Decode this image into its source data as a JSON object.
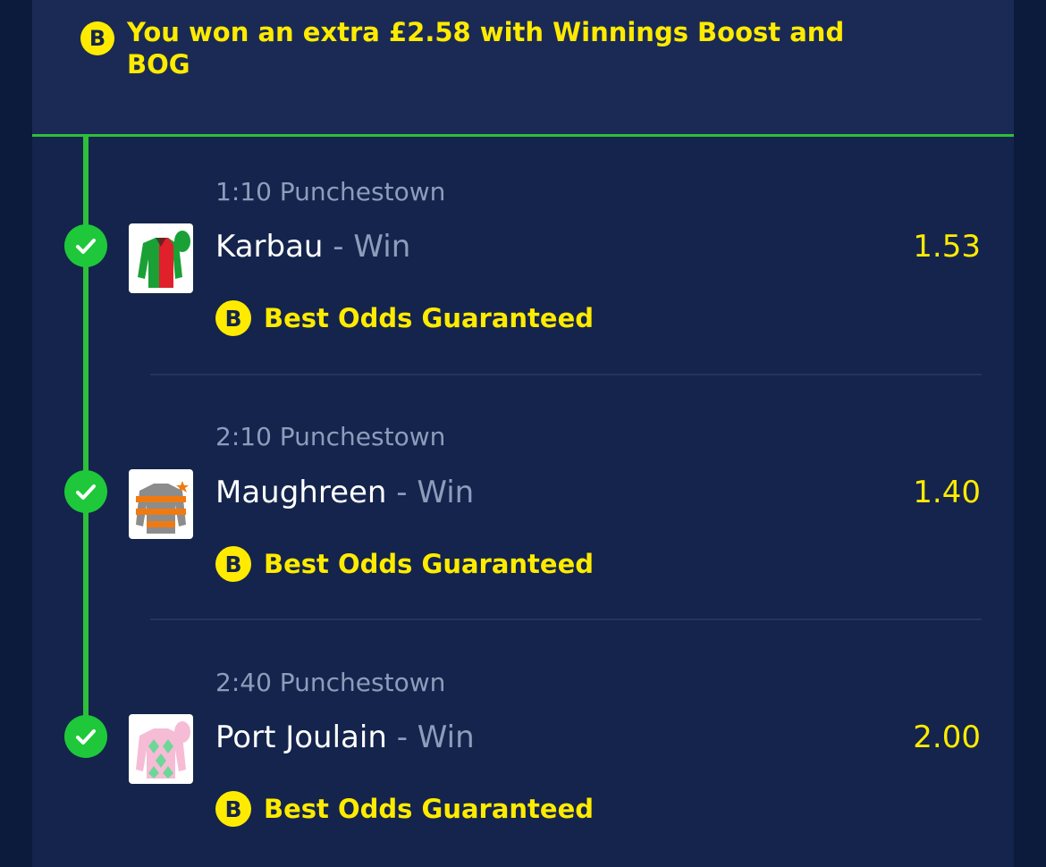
{
  "banner": {
    "badge": "B",
    "message": "You won an extra £2.58 with Winnings Boost and BOG"
  },
  "selections": [
    {
      "race": "1:10 Punchestown",
      "horse": "Karbau",
      "market": "- Win",
      "price": "1.53",
      "badge": "B",
      "promo": "Best Odds Guaranteed",
      "status": "won",
      "silk_icon": "green-red-jockey-silk"
    },
    {
      "race": "2:10 Punchestown",
      "horse": "Maughreen",
      "market": "- Win",
      "price": "1.40",
      "badge": "B",
      "promo": "Best Odds Guaranteed",
      "status": "won",
      "silk_icon": "orange-grey-hooped-jockey-silk"
    },
    {
      "race": "2:40 Punchestown",
      "horse": "Port Joulain",
      "market": "- Win",
      "price": "2.00",
      "badge": "B",
      "promo": "Best Odds Guaranteed",
      "status": "won",
      "silk_icon": "pink-green-diamonds-jockey-silk"
    }
  ],
  "colors": {
    "background": "#0c1a3c",
    "panel": "#14244c",
    "accent_yellow": "#ffeb00",
    "win_green": "#2ec03a",
    "muted_text": "#8e9cbc"
  }
}
